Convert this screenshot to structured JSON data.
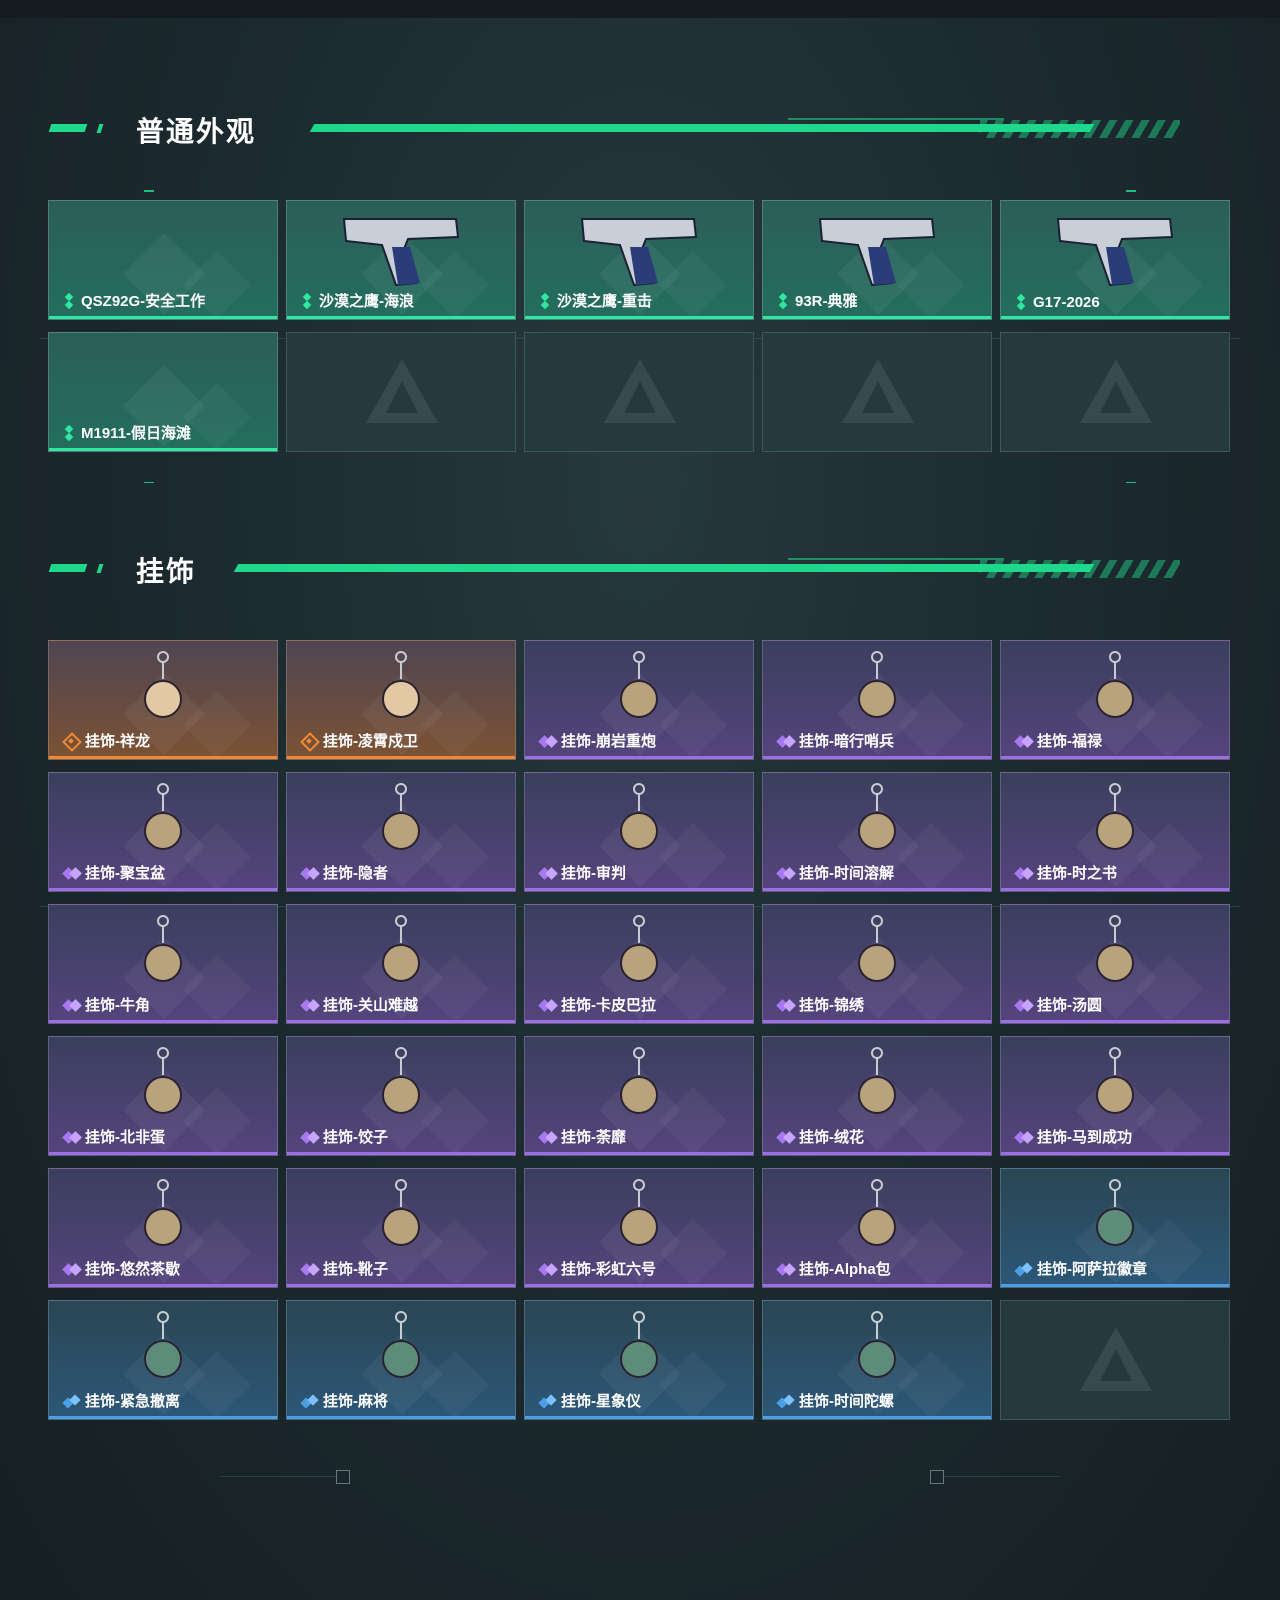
{
  "colors": {
    "accent": "#20d88b",
    "green_rarity": "#2ee7a0",
    "orange_rarity": "#f08a35",
    "purple_rarity": "#9d6de6",
    "blue_rarity": "#4a9fe6"
  },
  "sections": {
    "skins": {
      "title": "普通外观",
      "items": [
        {
          "label": "QSZ92G-安全工作",
          "rarity": "green",
          "icon": "none"
        },
        {
          "label": "沙漠之鹰-海浪",
          "rarity": "green",
          "icon": "pistol-icon"
        },
        {
          "label": "沙漠之鹰-重击",
          "rarity": "green",
          "icon": "pistol-icon"
        },
        {
          "label": "93R-典雅",
          "rarity": "green",
          "icon": "pistol-icon"
        },
        {
          "label": "G17-2026",
          "rarity": "green",
          "icon": "pistol-icon"
        },
        {
          "label": "M1911-假日海滩",
          "rarity": "green",
          "icon": "none"
        }
      ],
      "empty_slots": 4
    },
    "charms": {
      "title": "挂饰",
      "items": [
        {
          "label": "挂饰-祥龙",
          "rarity": "orange"
        },
        {
          "label": "挂饰-凌霄戍卫",
          "rarity": "orange"
        },
        {
          "label": "挂饰-崩岩重炮",
          "rarity": "purple"
        },
        {
          "label": "挂饰-暗行哨兵",
          "rarity": "purple"
        },
        {
          "label": "挂饰-福禄",
          "rarity": "purple"
        },
        {
          "label": "挂饰-聚宝盆",
          "rarity": "purple"
        },
        {
          "label": "挂饰-隐者",
          "rarity": "purple"
        },
        {
          "label": "挂饰-审判",
          "rarity": "purple"
        },
        {
          "label": "挂饰-时间溶解",
          "rarity": "purple"
        },
        {
          "label": "挂饰-时之书",
          "rarity": "purple"
        },
        {
          "label": "挂饰-牛角",
          "rarity": "purple"
        },
        {
          "label": "挂饰-关山难越",
          "rarity": "purple"
        },
        {
          "label": "挂饰-卡皮巴拉",
          "rarity": "purple"
        },
        {
          "label": "挂饰-锦绣",
          "rarity": "purple"
        },
        {
          "label": "挂饰-汤圆",
          "rarity": "purple"
        },
        {
          "label": "挂饰-北非蛋",
          "rarity": "purple"
        },
        {
          "label": "挂饰-饺子",
          "rarity": "purple"
        },
        {
          "label": "挂饰-荼靡",
          "rarity": "purple"
        },
        {
          "label": "挂饰-绒花",
          "rarity": "purple"
        },
        {
          "label": "挂饰-马到成功",
          "rarity": "purple"
        },
        {
          "label": "挂饰-悠然茶歇",
          "rarity": "purple"
        },
        {
          "label": "挂饰-靴子",
          "rarity": "purple"
        },
        {
          "label": "挂饰-彩虹六号",
          "rarity": "purple"
        },
        {
          "label": "挂饰-Alpha包",
          "rarity": "purple"
        },
        {
          "label": "挂饰-阿萨拉徽章",
          "rarity": "blue"
        },
        {
          "label": "挂饰-紧急撤离",
          "rarity": "blue"
        },
        {
          "label": "挂饰-麻将",
          "rarity": "blue"
        },
        {
          "label": "挂饰-星象仪",
          "rarity": "blue"
        },
        {
          "label": "挂饰-时间陀螺",
          "rarity": "blue"
        }
      ],
      "empty_slots": 1
    }
  }
}
